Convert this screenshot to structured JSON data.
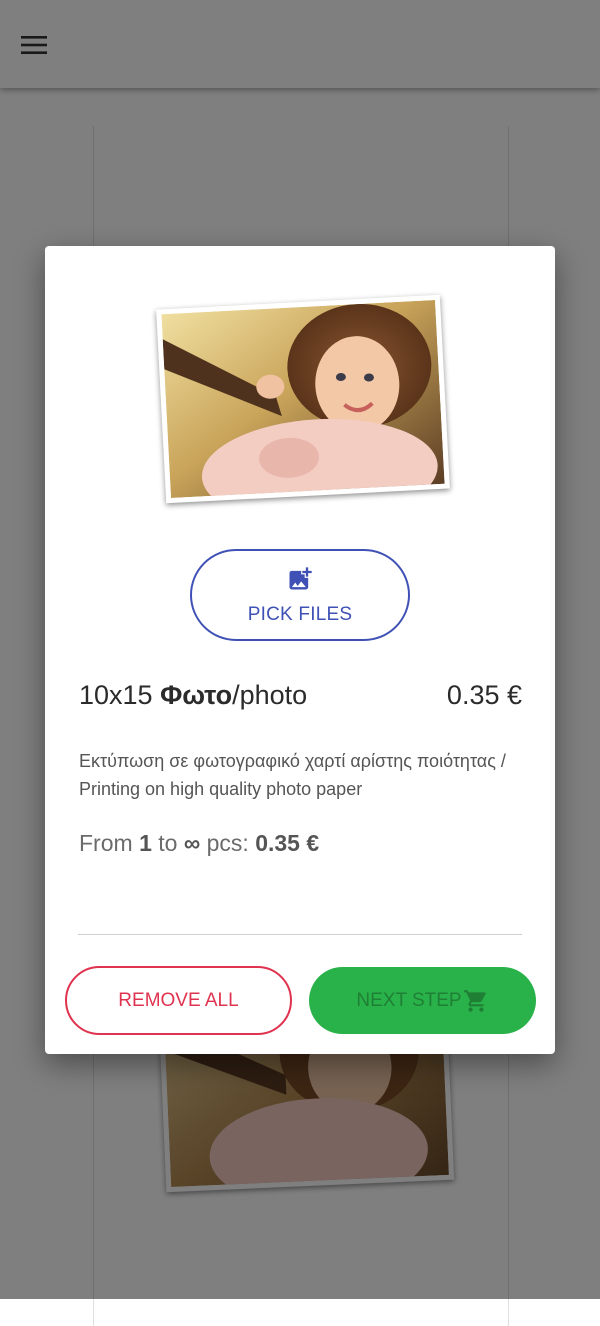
{
  "app_bar": {
    "menu_icon": "hamburger-menu-icon"
  },
  "background": {
    "photo_description_icon": "child-photo-thumbnail"
  },
  "dialog": {
    "photo_icon": "child-photo-preview",
    "pick_files": {
      "icon": "add-photo-icon",
      "label": "PICK FILES"
    },
    "product": {
      "size": "10x15",
      "name_bold": "Φωτο",
      "name_suffix": "/photo",
      "price": "0.35 €"
    },
    "description": "Εκτύπωση σε φωτογραφικό χαρτί αρίστης ποιότητας / Printing on high quality photo paper",
    "tier": {
      "from_label": "From",
      "from_value": "1",
      "to_label": "to",
      "to_value": "∞",
      "unit_label": "pcs:",
      "price": "0.35 €"
    },
    "buttons": {
      "remove_all": "REMOVE ALL",
      "next_step": "NEXT STEP",
      "next_step_icon": "shopping-cart-icon"
    }
  },
  "colors": {
    "accent_blue": "#3f51b5",
    "remove_red": "#e0334f",
    "next_green": "#2ab24a",
    "scrim": "rgba(0,0,0,0.5)"
  }
}
